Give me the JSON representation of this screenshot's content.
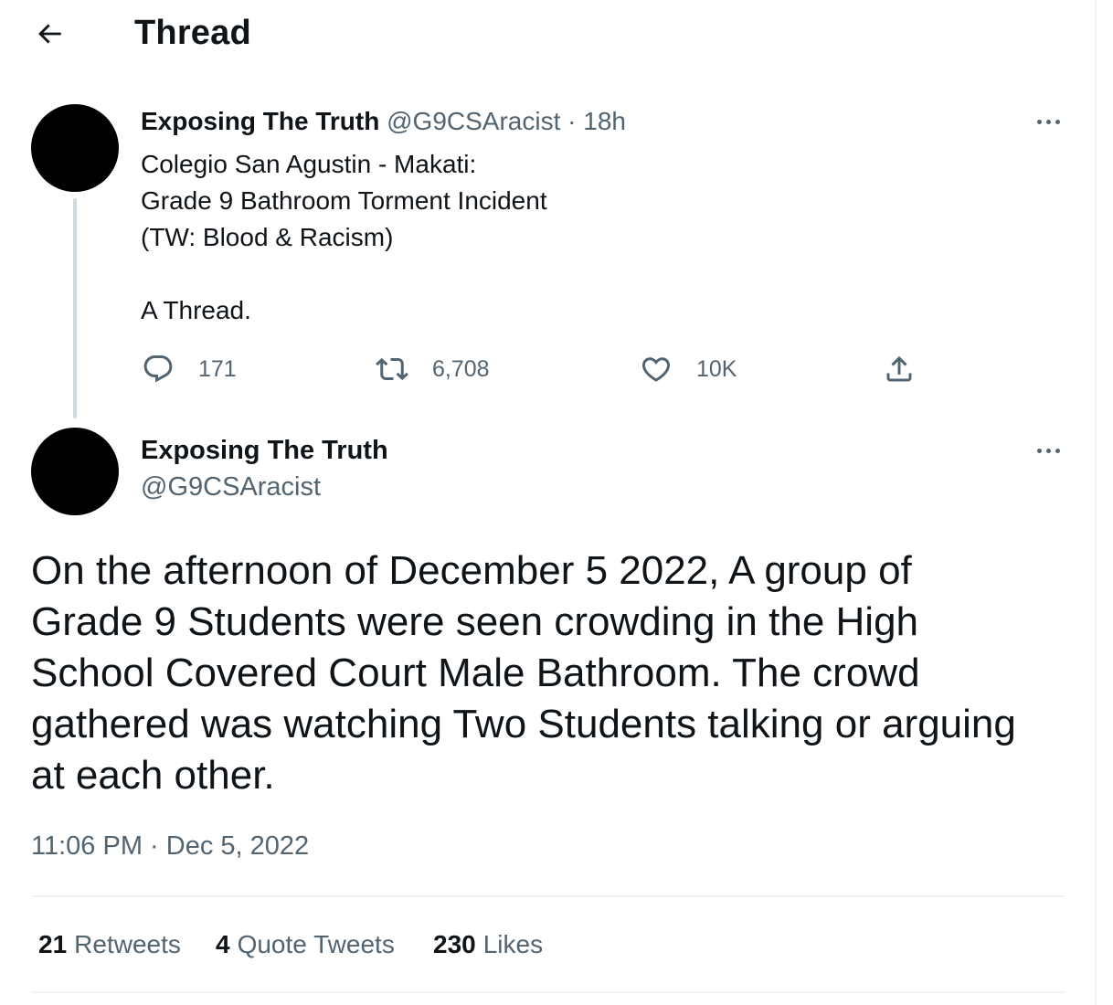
{
  "header": {
    "title": "Thread",
    "back_icon": "arrow-left-icon"
  },
  "thread": {
    "tweet1": {
      "author_name": "Exposing The Truth",
      "handle": "@G9CSAracist",
      "separator": "·",
      "relative_time": "18h",
      "text_lines": [
        "Colegio San Agustin - Makati:",
        "Grade 9 Bathroom Torment Incident",
        "(TW: Blood & Racism)",
        "",
        "A Thread."
      ],
      "actions": {
        "reply_count": "171",
        "retweet_count": "6,708",
        "like_count": "10K"
      }
    },
    "tweet2": {
      "author_name": "Exposing The Truth",
      "handle": "@G9CSAracist",
      "text_lines": [
        "On the afternoon of December 5 2022, A group of",
        "Grade 9 Students were seen crowding in the High",
        "School Covered Court Male Bathroom. The crowd",
        "gathered was watching Two Students talking or arguing",
        "at each other."
      ],
      "time": "11:06 PM",
      "separator": "·",
      "date": "Dec 5, 2022",
      "stats": {
        "retweets_count": "21",
        "retweets_label": "Retweets",
        "quotes_count": "4",
        "quotes_label": "Quote Tweets",
        "likes_count": "230",
        "likes_label": "Likes"
      }
    }
  },
  "colors": {
    "text_primary": "#0f1419",
    "text_secondary": "#536471",
    "divider": "#eff3f4",
    "thread_line": "#cfd9de"
  }
}
